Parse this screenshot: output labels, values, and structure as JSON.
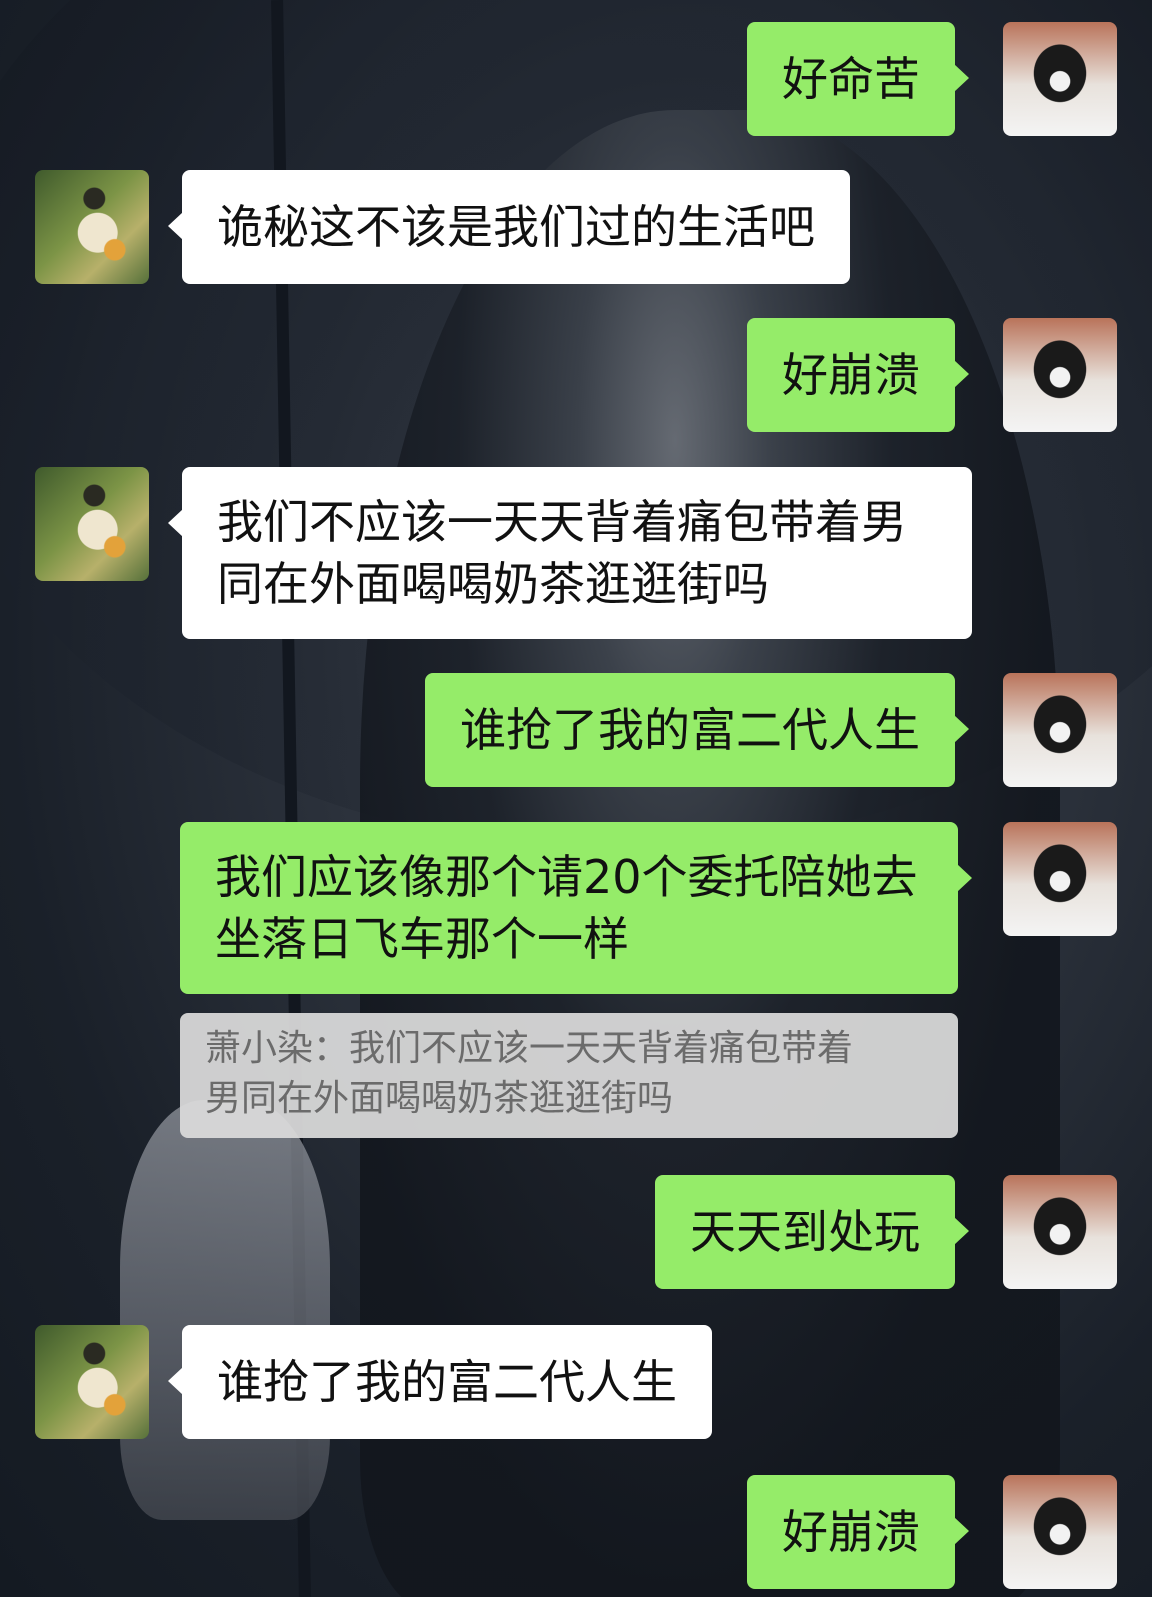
{
  "messages": [
    {
      "side": "me",
      "text": "好命苦",
      "avatar": "dog-avatar"
    },
    {
      "side": "them",
      "text": "诡秘这不该是我们过的生活吧",
      "avatar": "girl-avatar"
    },
    {
      "side": "me",
      "text": "好崩溃",
      "avatar": "dog-avatar"
    },
    {
      "side": "them",
      "line1": "我们不应该一天天背着痛包带着男",
      "line2": "同在外面喝喝奶茶逛逛街吗",
      "avatar": "girl-avatar"
    },
    {
      "side": "me",
      "text": "谁抢了我的富二代人生",
      "avatar": "dog-avatar"
    },
    {
      "side": "me",
      "line1": "我们应该像那个请20个委托陪她去",
      "line2": "坐落日飞车那个一样",
      "avatar": "dog-avatar"
    },
    {
      "side": "me",
      "text": "天天到处玩",
      "avatar": "dog-avatar"
    },
    {
      "side": "them",
      "text": "谁抢了我的富二代人生",
      "avatar": "girl-avatar"
    },
    {
      "side": "me",
      "text": "好崩溃",
      "avatar": "dog-avatar"
    }
  ],
  "quote": {
    "line1": "萧小染：我们不应该一天天背着痛包带着",
    "line2": "男同在外面喝喝奶茶逛逛街吗"
  },
  "colors": {
    "my_bubble": "#95ec69",
    "their_bubble": "#ffffff",
    "quote_bg": "#dcdcdc"
  }
}
